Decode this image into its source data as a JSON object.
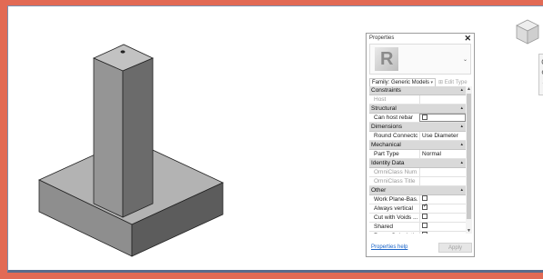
{
  "properties": {
    "title": "Properties",
    "close_glyph": "✕",
    "logo_letter": "R",
    "family_select": "Family: Generic Models",
    "edit_type": "Edit Type",
    "help_link": "Properties help",
    "apply": "Apply",
    "groups": [
      {
        "label": "Constraints",
        "rows": [
          {
            "key": "Host",
            "value": "",
            "dim": true
          }
        ]
      },
      {
        "label": "Structural",
        "rows": [
          {
            "key": "Can host rebar",
            "checkbox": false,
            "active": true
          }
        ]
      },
      {
        "label": "Dimensions",
        "rows": [
          {
            "key": "Round Connecto...",
            "value": "Use Diameter"
          }
        ]
      },
      {
        "label": "Mechanical",
        "rows": [
          {
            "key": "Part Type",
            "value": "Normal"
          }
        ]
      },
      {
        "label": "Identity Data",
        "rows": [
          {
            "key": "OmniClass Num...",
            "value": "",
            "dim": true
          },
          {
            "key": "OmniClass Title",
            "value": "",
            "dim": true
          }
        ]
      },
      {
        "label": "Other",
        "rows": [
          {
            "key": "Work Plane-Bas...",
            "checkbox": false
          },
          {
            "key": "Always vertical",
            "checkbox": true
          },
          {
            "key": "Cut with Voids ...",
            "checkbox": false
          },
          {
            "key": "Shared",
            "checkbox": false
          },
          {
            "key": "Room Calculatio...",
            "checkbox": false
          }
        ]
      }
    ]
  },
  "icons": {
    "viewcube": "viewcube-icon",
    "navbar": "navigation-bar-icon",
    "edit_type": "edit-type-icon"
  },
  "colors": {
    "background": "#e26a55",
    "model_top": "#b9b9b9",
    "model_left": "#8f8f8f",
    "model_right": "#5e5e5e"
  }
}
